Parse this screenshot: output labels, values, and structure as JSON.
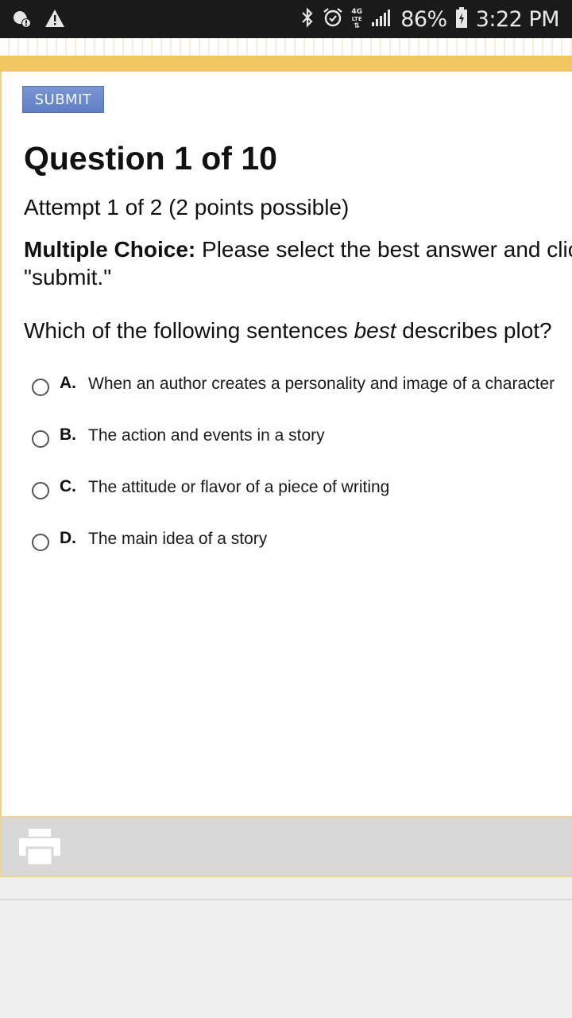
{
  "status_bar": {
    "left_icons": [
      "notification-alert-icon",
      "warning-icon"
    ],
    "right_icons": [
      "bluetooth-icon",
      "alarm-icon",
      "signal-icon",
      "battery-charging-icon"
    ],
    "network": {
      "top": "4G",
      "mid": "LTE"
    },
    "battery_percent": "86%",
    "time": "3:22 PM"
  },
  "quiz": {
    "submit_label": "SUBMIT",
    "title": "Question 1 of 10",
    "attempt": "Attempt 1 of 2 (2 points possible)",
    "instructions": {
      "bold_label": "Multiple Choice:",
      "text": "Please select the best answer and click",
      "continuation": "\"submit.\""
    },
    "prompt": {
      "before": "Which of the following sentences",
      "emphasis": "best",
      "after": "describes plot?"
    },
    "options": [
      {
        "letter": "A.",
        "text": "When an author creates a personality and image of a character",
        "selected": false
      },
      {
        "letter": "B.",
        "text": "The action and events in a story",
        "selected": false
      },
      {
        "letter": "C.",
        "text": "The attitude or flavor of a piece of writing",
        "selected": false
      },
      {
        "letter": "D.",
        "text": "The main idea of a story",
        "selected": false
      }
    ]
  },
  "toolbar": {
    "icons": [
      "print-icon"
    ]
  },
  "colors": {
    "accent_rule": "#f1c55f",
    "submit_button": "#6f8ccd",
    "toolbar": "#d8d8d8",
    "status_bar": "#1a1a1a"
  }
}
